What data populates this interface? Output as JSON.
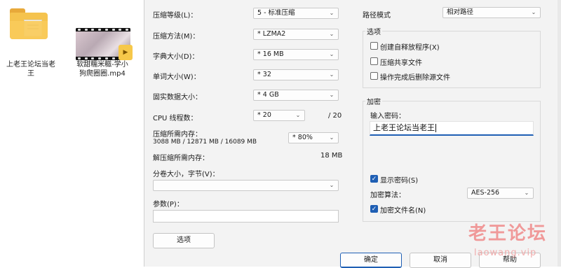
{
  "desktop": {
    "folder": {
      "line1": "上老王论坛当老",
      "line2": "王"
    },
    "video": {
      "line1": "软甜糯米糍-学小",
      "line2": "狗爬圈圈.mp4"
    }
  },
  "dialog": {
    "compression_level": {
      "label": "压缩等级(L)：",
      "value": "5 - 标准压缩"
    },
    "compression_method": {
      "label": "压缩方法(M)：",
      "value": "* LZMA2"
    },
    "dictionary_size": {
      "label": "字典大小(D)：",
      "value": "* 16 MB"
    },
    "word_size": {
      "label": "单词大小(W)：",
      "value": "* 32"
    },
    "solid_block_size": {
      "label": "固实数据大小：",
      "value": "* 4 GB"
    },
    "cpu_threads": {
      "label": "CPU 线程数：",
      "value": "* 20",
      "max": "/ 20"
    },
    "memory_compress": {
      "label": "压缩所需内存：",
      "detail": "3088 MB / 12871 MB / 16089 MB",
      "value": "* 80%"
    },
    "memory_decompress": {
      "label": "解压缩所需内存：",
      "value": "18 MB"
    },
    "split_volumes": {
      "label": "分卷大小，字节(V)：",
      "value": ""
    },
    "parameters": {
      "label": "参数(P)：",
      "value": ""
    },
    "options_button": "选项",
    "path_mode": {
      "label": "路径模式",
      "value": "相对路径"
    },
    "options_group": {
      "title": "选项",
      "items": [
        {
          "label": "创建自释放程序(X)",
          "checked": false
        },
        {
          "label": "压缩共享文件",
          "checked": false
        },
        {
          "label": "操作完成后删除源文件",
          "checked": false
        }
      ]
    },
    "encryption": {
      "title": "加密",
      "password_label": "输入密码：",
      "password_value": "上老王论坛当老王",
      "show_password": {
        "label": "显示密码(S)",
        "checked": true
      },
      "method_label": "加密算法：",
      "method_value": "AES-256",
      "encrypt_names": {
        "label": "加密文件名(N)",
        "checked": true
      }
    },
    "buttons": {
      "ok": "确定",
      "cancel": "取消",
      "help": "帮助"
    }
  },
  "watermark": {
    "title": "老王论坛",
    "url": "laowang.vip"
  },
  "colors": {
    "accent": "#1f5fb4",
    "dialog_bg": "#f3f3f3",
    "watermark": "#f08a8a"
  }
}
